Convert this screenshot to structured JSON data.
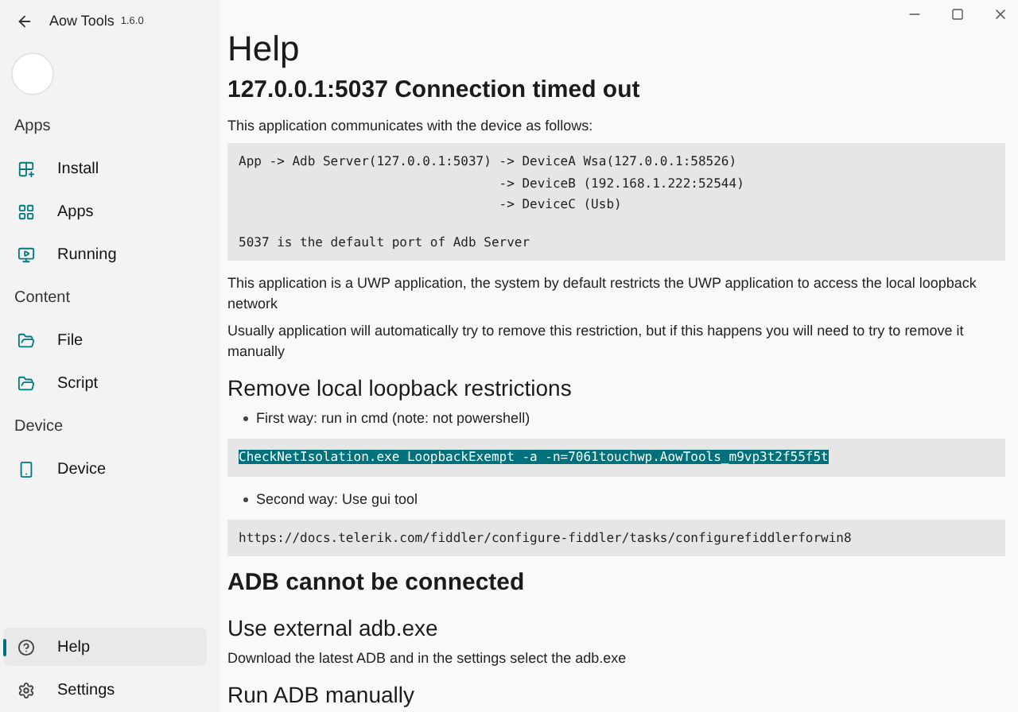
{
  "app": {
    "title": "Aow Tools",
    "version": "1.6.0"
  },
  "nav": [
    {
      "kind": "header",
      "label": "Apps"
    },
    {
      "kind": "item",
      "label": "Install",
      "selected": false
    },
    {
      "kind": "item",
      "label": "Apps",
      "selected": false
    },
    {
      "kind": "item",
      "label": "Running",
      "selected": false
    },
    {
      "kind": "header",
      "label": "Content"
    },
    {
      "kind": "item",
      "label": "File",
      "selected": false
    },
    {
      "kind": "item",
      "label": "Script",
      "selected": false
    },
    {
      "kind": "header",
      "label": "Device"
    },
    {
      "kind": "item",
      "label": "Device",
      "selected": false
    }
  ],
  "footer_nav": [
    {
      "label": "Help",
      "selected": true
    },
    {
      "label": "Settings",
      "selected": false
    }
  ],
  "page_title": "Help",
  "blocks": [
    {
      "kind": "h2",
      "text": "127.0.0.1:5037 Connection timed out"
    },
    {
      "kind": "p",
      "text": "This application communicates with the device as follows:"
    },
    {
      "kind": "code",
      "selected": false,
      "lines": [
        "App -> Adb Server(127.0.0.1:5037) -> DeviceA Wsa(127.0.0.1:58526)",
        "                                  -> DeviceB (192.168.1.222:52544)",
        "                                  -> DeviceC (Usb)"
      ],
      "note": "5037 is the default port of Adb Server"
    },
    {
      "kind": "p",
      "text": "This application is a UWP application, the system by default restricts the UWP application to access the local loopback network"
    },
    {
      "kind": "p",
      "text": "Usually application will automatically try to remove this restriction, but if this happens you will need to try to remove it manually"
    },
    {
      "kind": "h3",
      "text": "Remove local loopback restrictions"
    },
    {
      "kind": "bullet",
      "text": "First way: run in cmd (note: not powershell)"
    },
    {
      "kind": "code",
      "selected": true,
      "lines": [
        "CheckNetIsolation.exe LoopbackExempt -a -n=7061touchwp.AowTools_m9vp3t2f55f5t"
      ]
    },
    {
      "kind": "bullet",
      "text": "Second way: Use gui tool"
    },
    {
      "kind": "code",
      "selected": false,
      "lines": [
        "https://docs.telerik.com/fiddler/configure-fiddler/tasks/configurefiddlerforwin8"
      ]
    },
    {
      "kind": "h2",
      "text": "ADB cannot be connected"
    },
    {
      "kind": "h3",
      "text": "Use external adb.exe"
    },
    {
      "kind": "p",
      "text": "Download the latest ADB and in the settings select the adb.exe"
    },
    {
      "kind": "h3",
      "text": "Run ADB manually"
    }
  ]
}
